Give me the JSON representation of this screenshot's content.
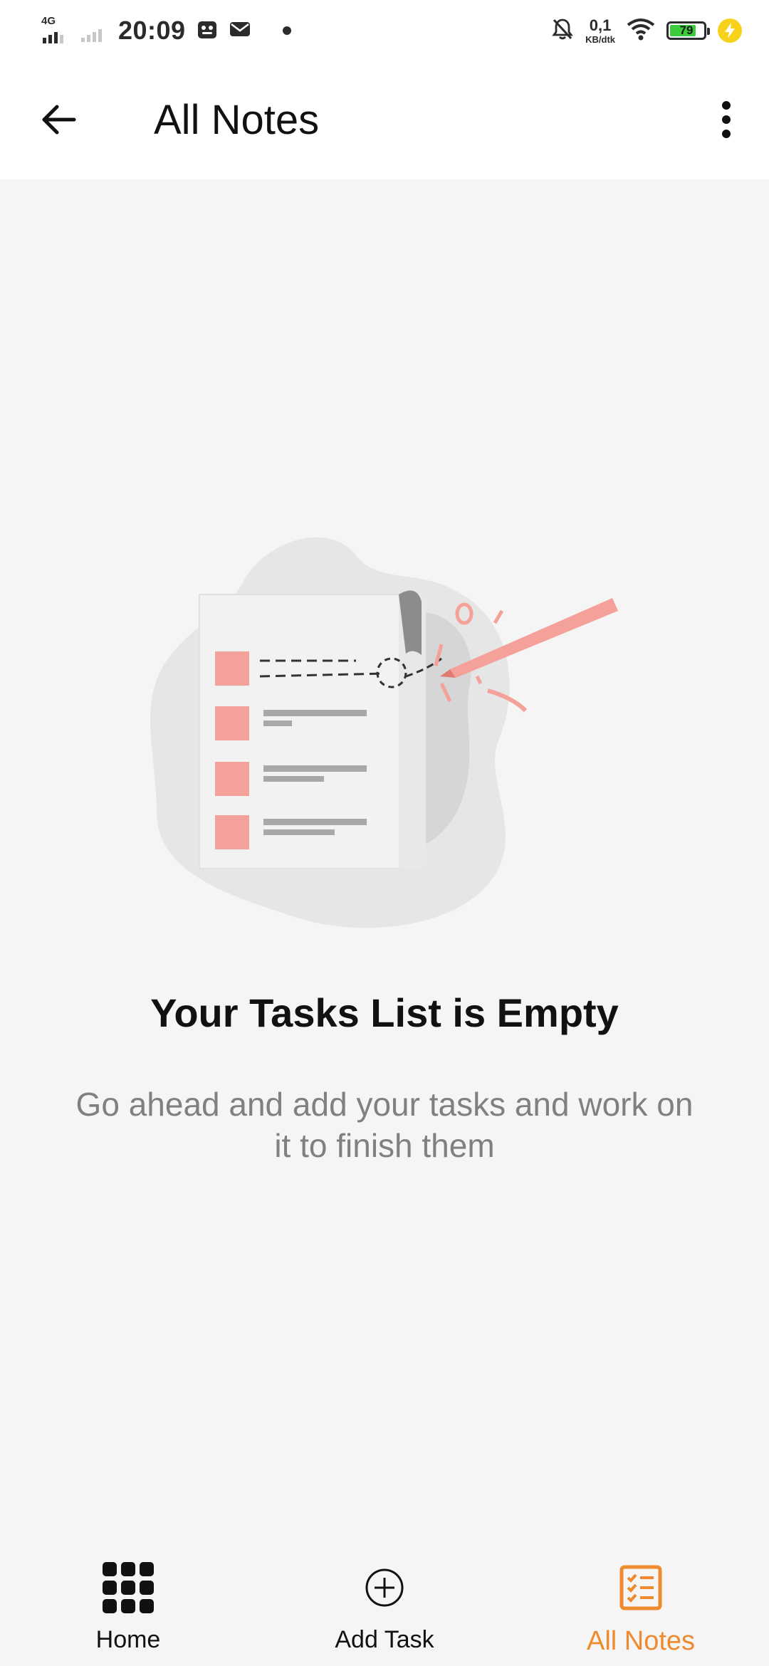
{
  "status_bar": {
    "network_type": "4G",
    "time": "20:09",
    "net_speed_value": "0,1",
    "net_speed_unit": "KB/dtk",
    "battery_level": 79,
    "battery_text": "79"
  },
  "app_bar": {
    "title": "All Notes",
    "back_icon": "arrow-left-icon",
    "more_icon": "more-vertical-icon"
  },
  "empty_state": {
    "title": "Your Tasks List is Empty",
    "message": "Go ahead and add your tasks and work on it to finish them"
  },
  "bottom_nav": {
    "items": [
      {
        "label": "Home",
        "icon": "grid-icon",
        "active": false
      },
      {
        "label": "Add Task",
        "icon": "add-circle-icon",
        "active": false
      },
      {
        "label": "All Notes",
        "icon": "checklist-icon",
        "active": true
      }
    ]
  },
  "colors": {
    "accent": "#ef8a2e",
    "background": "#f5f5f5",
    "bar_background": "#ffffff",
    "text_muted": "#808080",
    "battery_green": "#3ccb3c",
    "charging_yellow": "#f7d21a",
    "illustration_pink": "#f4a19a"
  }
}
